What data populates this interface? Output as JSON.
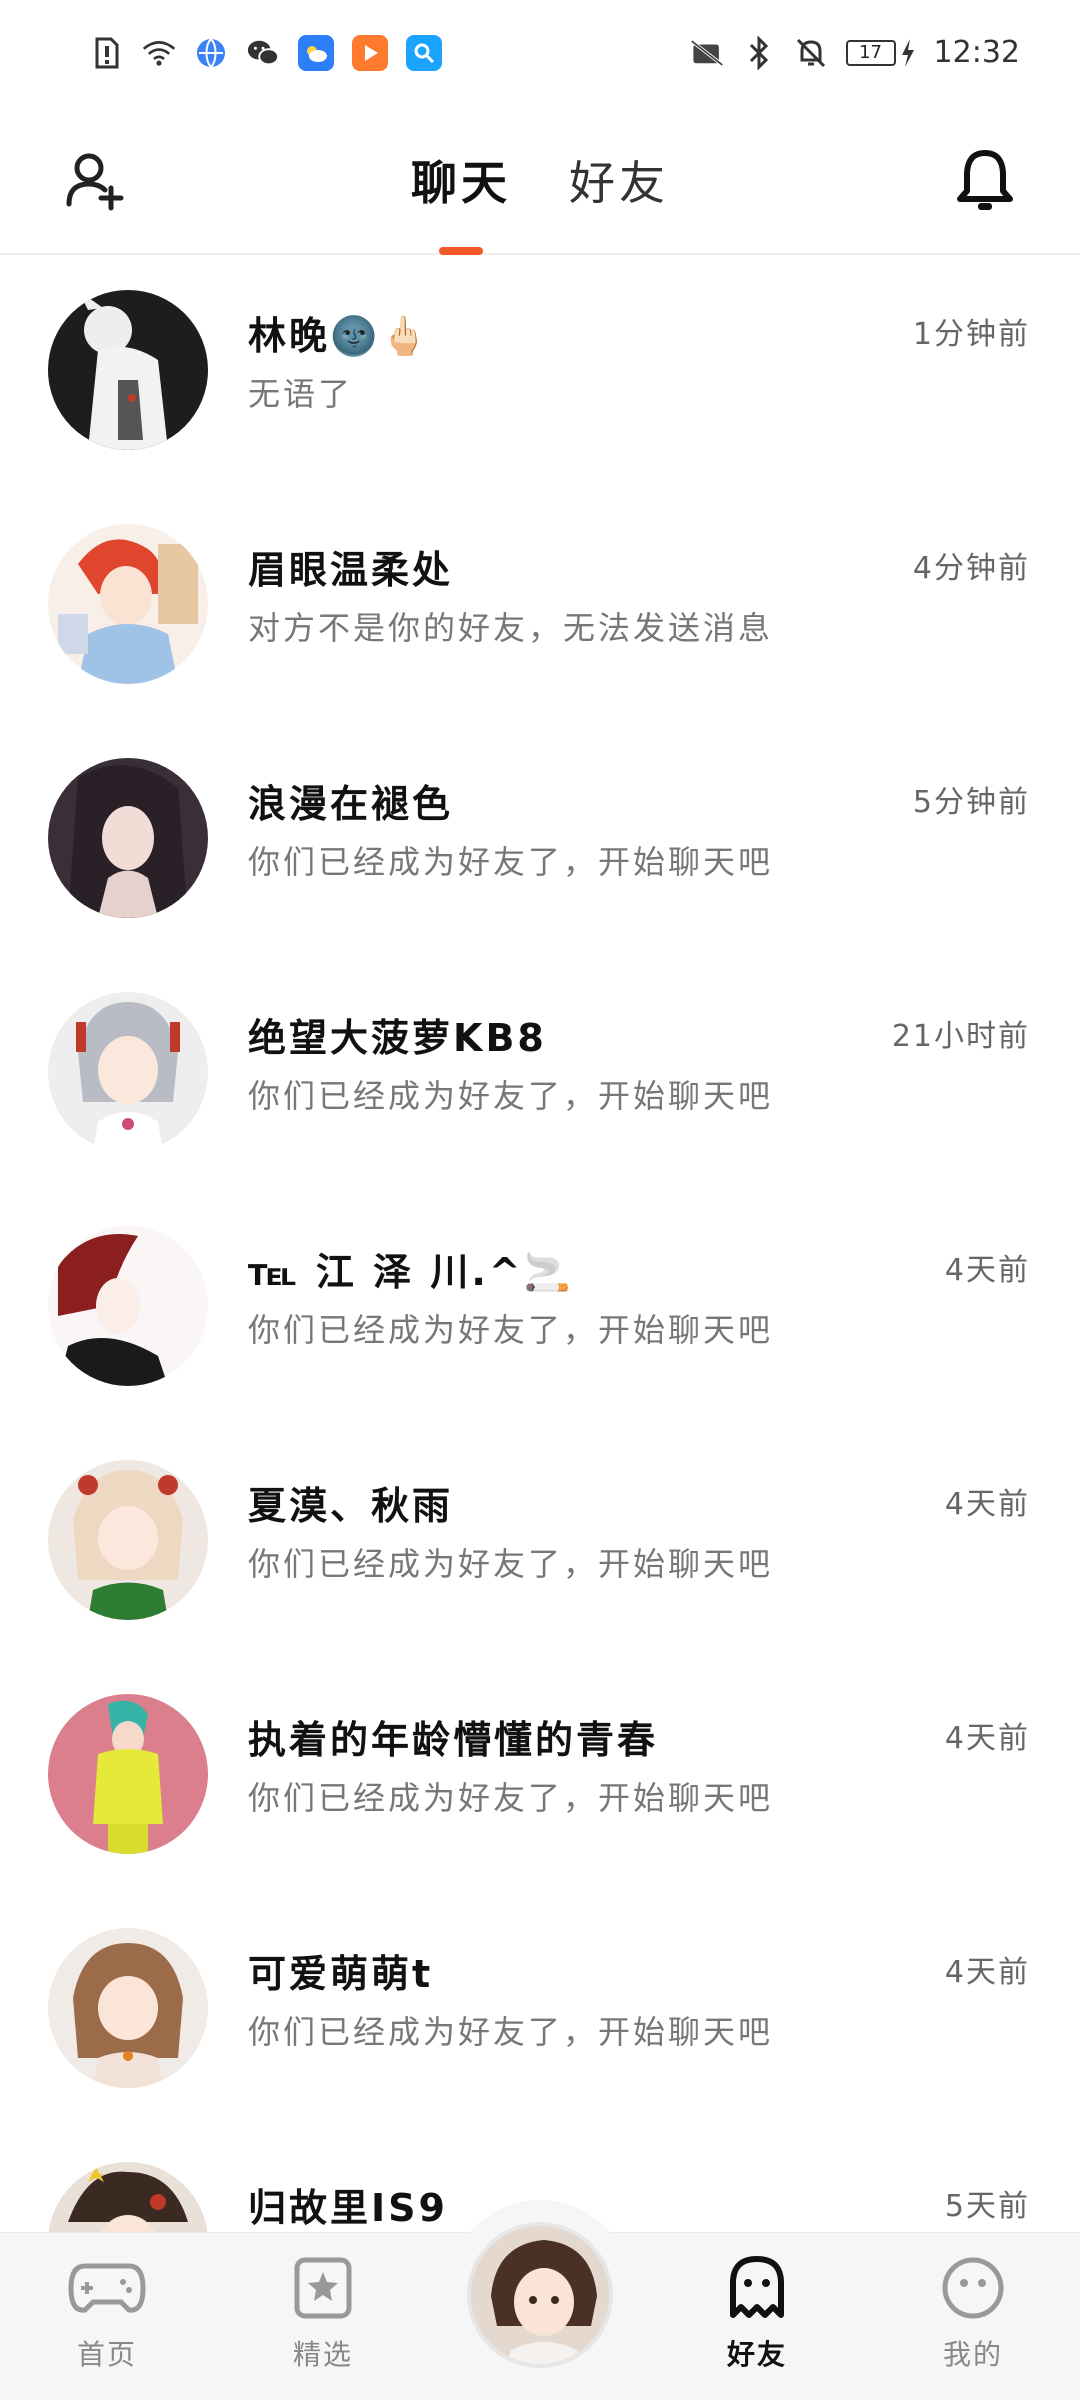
{
  "status_bar": {
    "time": "12:32",
    "battery": "17",
    "icons": [
      "sim-alert-icon",
      "wifi-icon",
      "browser-icon",
      "wechat-icon",
      "weather-app-icon",
      "video-app-icon",
      "search-app-icon",
      "no-sim-icon",
      "bluetooth-icon",
      "mute-icon",
      "charging-icon"
    ]
  },
  "header": {
    "tabs": [
      {
        "label": "聊天",
        "active": true
      },
      {
        "label": "好友",
        "active": false
      }
    ],
    "accent_color": "#f15a24"
  },
  "chats": [
    {
      "name": "林晚🌚🖕🏻",
      "message": "无语了",
      "time": "1分钟前"
    },
    {
      "name": "眉眼温柔处",
      "message": "对方不是你的好友，无法发送消息",
      "time": "4分钟前"
    },
    {
      "name": "浪漫在褪色",
      "message": "你们已经成为好友了，开始聊天吧",
      "time": "5分钟前"
    },
    {
      "name": "绝望大菠萝KB8",
      "message": "你们已经成为好友了，开始聊天吧",
      "time": "21小时前"
    },
    {
      "name": "℡  江 泽 川.^🚬",
      "message": "你们已经成为好友了，开始聊天吧",
      "time": "4天前"
    },
    {
      "name": "夏漠、秋雨",
      "message": "你们已经成为好友了，开始聊天吧",
      "time": "4天前"
    },
    {
      "name": "执着的年龄懵懂的青春",
      "message": "你们已经成为好友了，开始聊天吧",
      "time": "4天前"
    },
    {
      "name": "可爱萌萌t",
      "message": "你们已经成为好友了，开始聊天吧",
      "time": "4天前"
    },
    {
      "name": "归故里IS9",
      "message": "",
      "time": "5天前"
    }
  ],
  "bottom_nav": {
    "items": [
      {
        "label": "首页",
        "icon": "gamepad-icon",
        "active": false
      },
      {
        "label": "精选",
        "icon": "star-card-icon",
        "active": false
      },
      {
        "label": "好友",
        "icon": "ghost-icon",
        "active": true
      },
      {
        "label": "我的",
        "icon": "smiley-icon",
        "active": false
      }
    ]
  }
}
